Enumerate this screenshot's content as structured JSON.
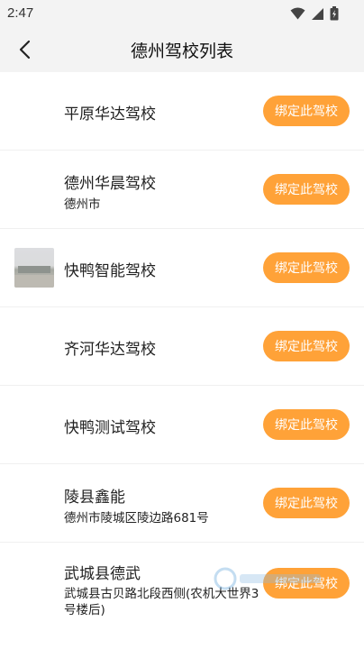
{
  "status_bar": {
    "time": "2:47",
    "icons": [
      "wifi-icon",
      "signal-icon",
      "battery-icon"
    ]
  },
  "header": {
    "title": "德州驾校列表",
    "back_icon": "back-arrow-icon"
  },
  "bind_button_color": "#ffa238",
  "schools": [
    {
      "name": "平原华达驾校",
      "address": "",
      "has_thumb": false,
      "button": "绑定此驾校"
    },
    {
      "name": "德州华晨驾校",
      "address": "德州市",
      "has_thumb": false,
      "button": "绑定此驾校"
    },
    {
      "name": "快鸭智能驾校",
      "address": "",
      "has_thumb": true,
      "button": "绑定此驾校"
    },
    {
      "name": "齐河华达驾校",
      "address": "",
      "has_thumb": false,
      "button": "绑定此驾校"
    },
    {
      "name": "快鸭测试驾校",
      "address": "",
      "has_thumb": false,
      "button": "绑定此驾校"
    },
    {
      "name": "陵县鑫能",
      "address": "德州市陵城区陵边路681号",
      "has_thumb": false,
      "button": "绑定此驾校"
    },
    {
      "name": "武城县德武",
      "address": "武城县古贝路北段西侧(农机大世界3号楼后)",
      "has_thumb": false,
      "button": "绑定此驾校"
    }
  ]
}
